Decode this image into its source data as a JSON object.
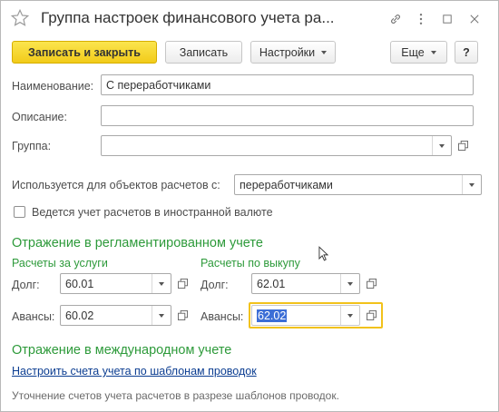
{
  "window": {
    "title": "Группа настроек финансового учета ра..."
  },
  "toolbar": {
    "save_close_label": "Записать и закрыть",
    "save_label": "Записать",
    "settings_label": "Настройки",
    "more_label": "Еще",
    "help_label": "?"
  },
  "form": {
    "name_label": "Наименование:",
    "name_value": "С переработчиками",
    "description_label": "Описание:",
    "description_value": "",
    "group_label": "Группа:",
    "group_value": "",
    "used_for_label": "Используется для объектов расчетов с:",
    "used_for_value": "переработчиками",
    "foreign_currency_label": "Ведется учет расчетов в иностранной валюте",
    "foreign_currency_checked": false
  },
  "regulated": {
    "title": "Отражение в регламентированном учете",
    "services": {
      "title": "Расчеты за услуги",
      "debt_label": "Долг:",
      "debt_value": "60.01",
      "advance_label": "Авансы:",
      "advance_value": "60.02"
    },
    "buyout": {
      "title": "Расчеты по выкупу",
      "debt_label": "Долг:",
      "debt_value": "62.01",
      "advance_label": "Авансы:",
      "advance_value": "62.02"
    }
  },
  "international": {
    "title": "Отражение в международном учете",
    "link_label": "Настроить счета учета по шаблонам проводок",
    "note": "Уточнение счетов учета расчетов в разрезе шаблонов проводок."
  },
  "colors": {
    "accent_green": "#2d9a3a",
    "primary_button": "#f2cb1a",
    "focus_border": "#f2c21b",
    "selection": "#3c6ed6",
    "link": "#0b3d91"
  }
}
